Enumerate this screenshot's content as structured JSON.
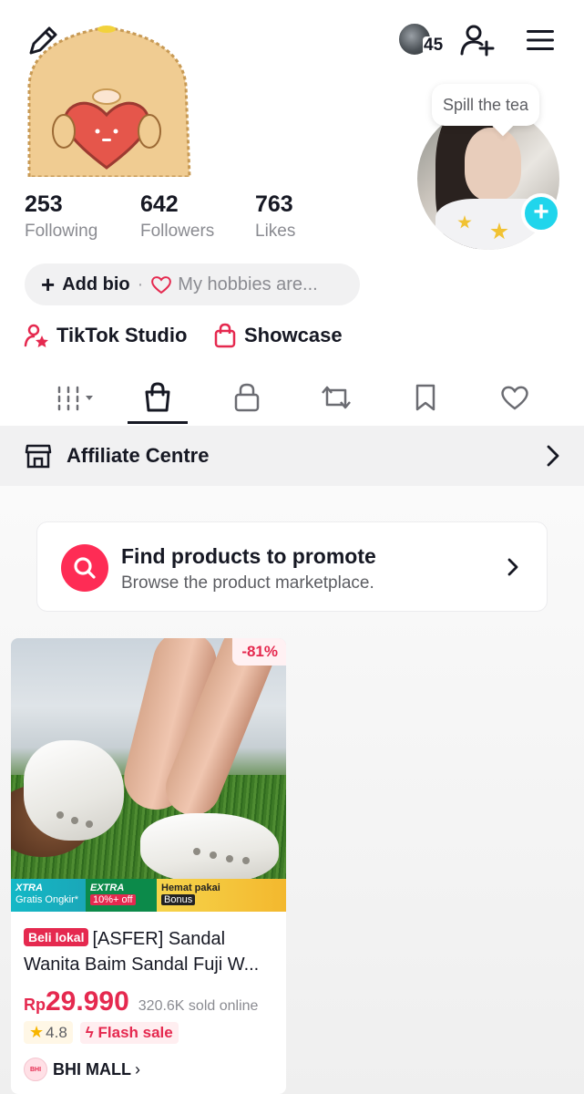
{
  "header": {
    "follower_count_badge": "45",
    "note_bubble": "Spill the tea",
    "icons": [
      "edit-pencil-icon",
      "follower-avatars",
      "add-friend-icon",
      "menu-icon"
    ]
  },
  "stats": [
    {
      "value": "253",
      "label": "Following"
    },
    {
      "value": "642",
      "label": "Followers"
    },
    {
      "value": "763",
      "label": "Likes"
    }
  ],
  "bio": {
    "plus": "+",
    "add_label": "Add bio",
    "separator": "·",
    "hobby_placeholder": "My hobbies are..."
  },
  "shortcuts": {
    "studio_label": "TikTok Studio",
    "showcase_label": "Showcase"
  },
  "tabs": [
    {
      "name": "videos-grid",
      "active": false
    },
    {
      "name": "shop",
      "active": true
    },
    {
      "name": "private",
      "active": false
    },
    {
      "name": "reposts",
      "active": false
    },
    {
      "name": "favorites",
      "active": false
    },
    {
      "name": "liked",
      "active": false
    }
  ],
  "affiliate": {
    "label": "Affiliate Centre"
  },
  "promo_card": {
    "title": "Find products to promote",
    "subtitle": "Browse the product marketplace."
  },
  "product": {
    "discount": "-81%",
    "strip": {
      "xtra_title": "XTRA",
      "xtra_sub": "Gratis Ongkir*",
      "extra_title": "EXTRA",
      "extra_sub": "10%+ off",
      "hemat_title": "Hemat pakai",
      "hemat_sub": "Bonus"
    },
    "badge": "Beli lokal",
    "title": "[ASFER] Sandal Wanita Baim Sandal Fuji W...",
    "currency": "Rp",
    "price": "29.990",
    "sold": "320.6K sold online",
    "rating": "4.8",
    "flash": "Flash sale",
    "shop_logo_text": "BHI",
    "shop_name": "BHI MALL"
  },
  "colors": {
    "accent": "#fe2c55",
    "add_photo": "#20d5ec",
    "text": "#161823",
    "muted": "#8a8b91"
  }
}
